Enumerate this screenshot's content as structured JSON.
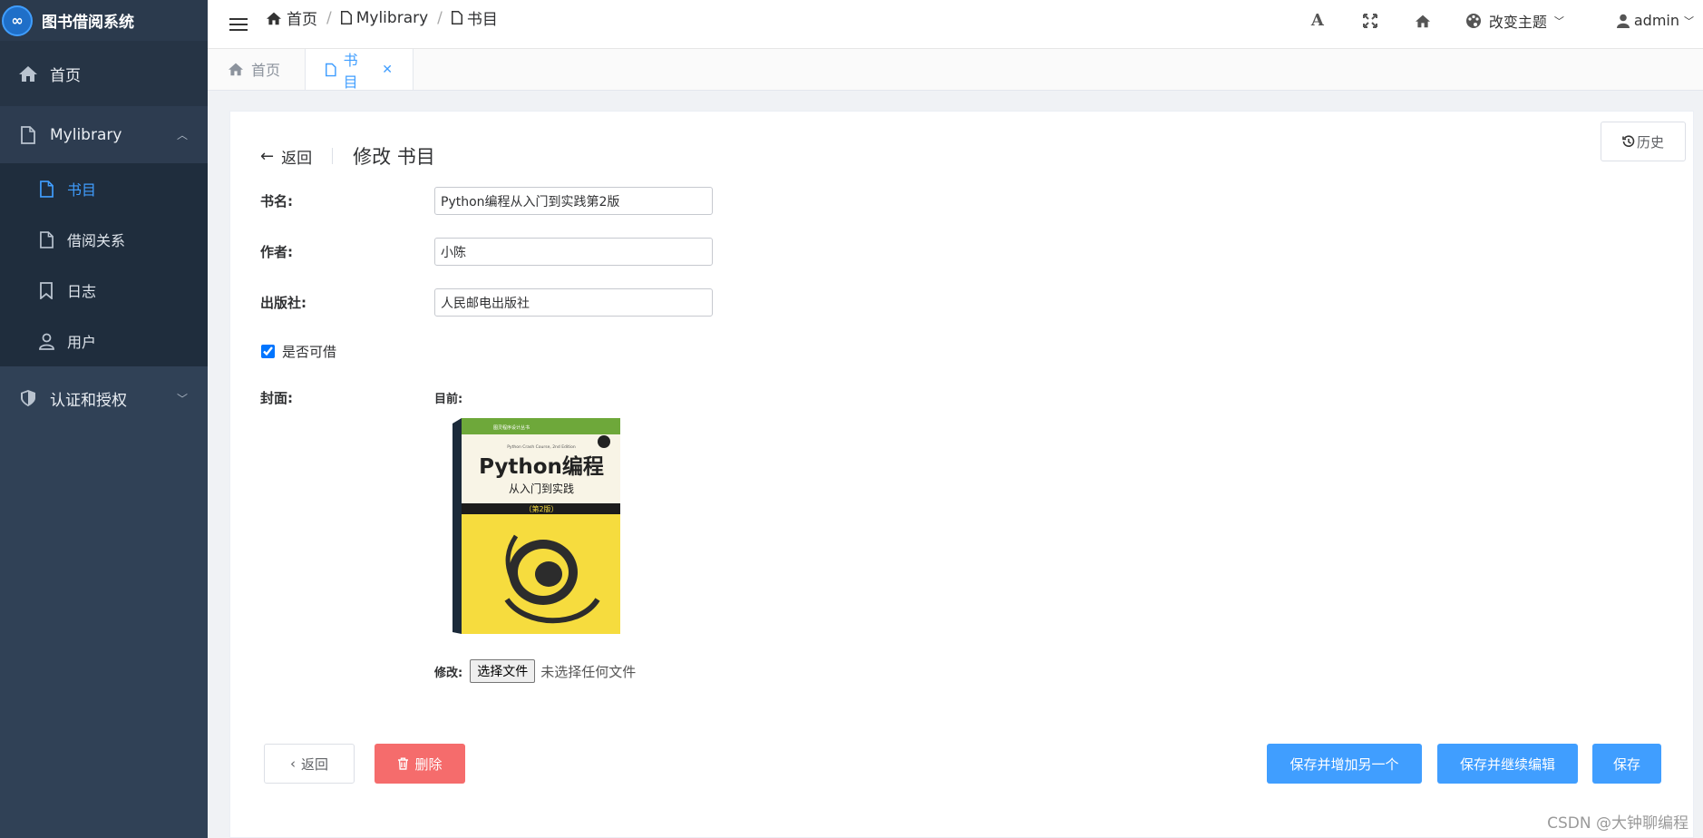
{
  "app": {
    "title": "图书借阅系统",
    "logo_icon": "infinity-icon",
    "accent_color": "#409eff",
    "sidebar_bg": "#304156"
  },
  "sidebar": {
    "home_label": "首页",
    "group_label": "Mylibrary",
    "items": [
      {
        "label": "书目",
        "icon": "file-icon",
        "active": true
      },
      {
        "label": "借阅关系",
        "icon": "file-icon",
        "active": false
      },
      {
        "label": "日志",
        "icon": "bookmark-icon",
        "active": false
      },
      {
        "label": "用户",
        "icon": "user-icon",
        "active": false
      }
    ],
    "auth_label": "认证和授权"
  },
  "header": {
    "breadcrumb": [
      "首页",
      "Mylibrary",
      "书目"
    ],
    "theme_label": "改变主题",
    "user_label": "admin",
    "font_tool": "A"
  },
  "tabs": [
    {
      "label": "首页",
      "active": false
    },
    {
      "label": "书目",
      "active": true
    }
  ],
  "page": {
    "back_label": "返回",
    "title": "修改 书目",
    "history_label": "历史"
  },
  "form": {
    "title_label": "书名:",
    "title_value": "Python编程从入门到实践第2版",
    "author_label": "作者:",
    "author_value": "小陈",
    "publisher_label": "出版社:",
    "publisher_value": "人民邮电出版社",
    "borrowable_label": "是否可借",
    "borrowable_checked": true,
    "cover_label": "封面:",
    "current_label": "目前:",
    "modify_label": "修改:",
    "file_button_label": "选择文件",
    "file_status": "未选择任何文件"
  },
  "cover": {
    "series": "图灵程序设计丛书",
    "english_title": "Python Crash Course, 2nd Edition",
    "main_title": "Python编程",
    "subtitle": "从入门到实践",
    "edition": "（第2版）"
  },
  "actions": {
    "back_label": "返回",
    "delete_label": "删除",
    "save_add_label": "保存并增加另一个",
    "save_continue_label": "保存并继续编辑",
    "save_label": "保存",
    "danger_color": "#f56c6c",
    "primary_color": "#409eff"
  },
  "watermark": "CSDN @大钟聊编程"
}
